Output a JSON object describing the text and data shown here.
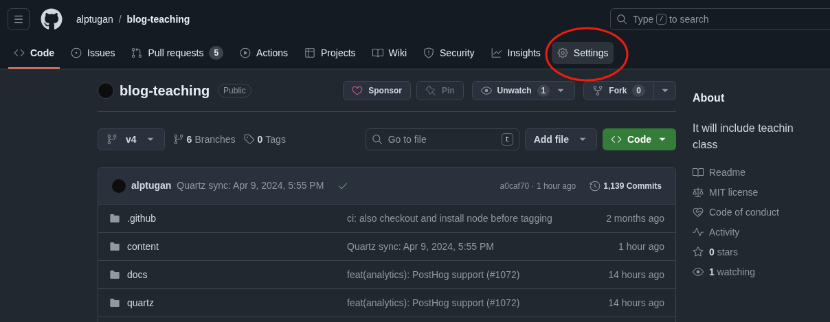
{
  "header": {
    "owner": "alptugan",
    "separator": "/",
    "repo": "blog-teaching",
    "search": {
      "placeholder_before": "Type",
      "shortcut": "/",
      "placeholder_after": "to search"
    }
  },
  "tabs": [
    {
      "label": "Code",
      "kind": "code",
      "selected": true,
      "hovered": false,
      "circled": false
    },
    {
      "label": "Issues",
      "kind": "issues",
      "selected": false,
      "hovered": false,
      "circled": false
    },
    {
      "label": "Pull requests",
      "kind": "pulls",
      "selected": false,
      "hovered": false,
      "circled": false,
      "count": "5"
    },
    {
      "label": "Actions",
      "kind": "actions",
      "selected": false,
      "hovered": false,
      "circled": false
    },
    {
      "label": "Projects",
      "kind": "projects",
      "selected": false,
      "hovered": false,
      "circled": false
    },
    {
      "label": "Wiki",
      "kind": "wiki",
      "selected": false,
      "hovered": false,
      "circled": false
    },
    {
      "label": "Security",
      "kind": "security",
      "selected": false,
      "hovered": false,
      "circled": false
    },
    {
      "label": "Insights",
      "kind": "insights",
      "selected": false,
      "hovered": false,
      "circled": false
    },
    {
      "label": "Settings",
      "kind": "settings",
      "selected": false,
      "hovered": true,
      "circled": true
    }
  ],
  "repo_head": {
    "name": "blog-teaching",
    "visibility": "Public",
    "actions": [
      {
        "kind": "sponsor",
        "label": "Sponsor",
        "disabled": false
      },
      {
        "kind": "pin",
        "label": "Pin",
        "disabled": true
      },
      {
        "kind": "watch",
        "label": "Unwatch",
        "count": "1"
      },
      {
        "kind": "fork",
        "label": "Fork",
        "count": "0"
      }
    ]
  },
  "toolbar": {
    "branch": "v4",
    "branches_count": "6",
    "branches_label": "Branches",
    "tags_count": "0",
    "tags_label": "Tags",
    "file_search": {
      "placeholder": "Go to file",
      "shortcut": "t"
    },
    "add_file": "Add file",
    "code_button": "Code"
  },
  "latest_commit": {
    "author": "alptugan",
    "message": "Quartz sync: Apr 9, 2024, 5:55 PM",
    "checks_passed": true,
    "hash_time": "a0caf70 · 1 hour ago",
    "commits_count": "1,139",
    "commits_label": "Commits"
  },
  "files": [
    {
      "name": ".github",
      "message": "ci: also checkout and install node before tagging",
      "time": "2 months ago"
    },
    {
      "name": "content",
      "message": "Quartz sync: Apr 9, 2024, 5:55 PM",
      "time": "1 hour ago"
    },
    {
      "name": "docs",
      "message": "feat(analytics): PostHog support (#1072)",
      "time": "14 hours ago"
    },
    {
      "name": "quartz",
      "message": "feat(analytics): PostHog support (#1072)",
      "time": "14 hours ago"
    }
  ],
  "about": {
    "title": "About",
    "description_lines": [
      "It will include teachin",
      "class"
    ],
    "items": [
      {
        "kind": "readme",
        "label": "Readme"
      },
      {
        "kind": "license",
        "label": "MIT license"
      },
      {
        "kind": "conduct",
        "label": "Code of conduct"
      },
      {
        "kind": "activity",
        "label": "Activity"
      },
      {
        "kind": "stars",
        "count": "0",
        "label": "stars"
      },
      {
        "kind": "watching",
        "count": "1",
        "label": "watching"
      }
    ]
  }
}
